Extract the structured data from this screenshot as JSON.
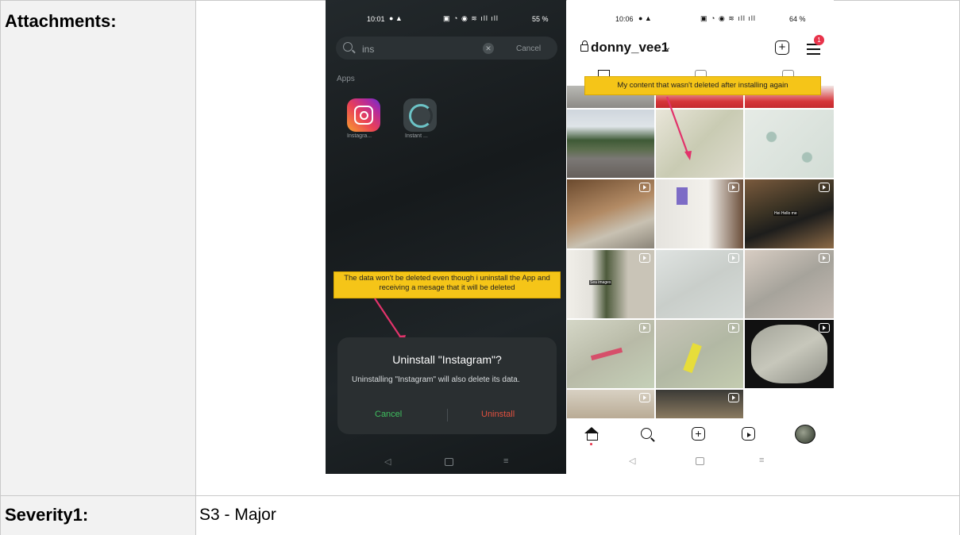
{
  "table": {
    "attachments_label": "Attachments:",
    "severity_label": "Severity1:",
    "severity_value": "S3 - Major"
  },
  "phone_left": {
    "status_time": "10:01",
    "status_battery": "55 %",
    "search_text": "ins",
    "search_cancel": "Cancel",
    "apps_heading": "Apps",
    "app1_label": "Instagra...",
    "app2_label": "Instant ...",
    "callout": "The data won't be deleted even though i uninstall the App and receiving a mesage that it will be deleted",
    "dialog": {
      "title": "Uninstall \"Instagram\"?",
      "message": "Uninstalling \"Instagram\" will also delete its data.",
      "cancel": "Cancel",
      "uninstall": "Uninstall"
    }
  },
  "phone_right": {
    "status_time": "10:06",
    "status_battery": "64 %",
    "username": "donny_vee1",
    "notification_count": "1",
    "callout": "My content that wasn't deleted after installing again",
    "tile_caption_1": "Hei Hello me",
    "tile_caption_2": "Sea images"
  },
  "colors": {
    "callout": "#f5c518",
    "cancel_green": "#3fbf5f",
    "uninstall_red": "#e0503f",
    "notification_red": "#e8334a"
  }
}
